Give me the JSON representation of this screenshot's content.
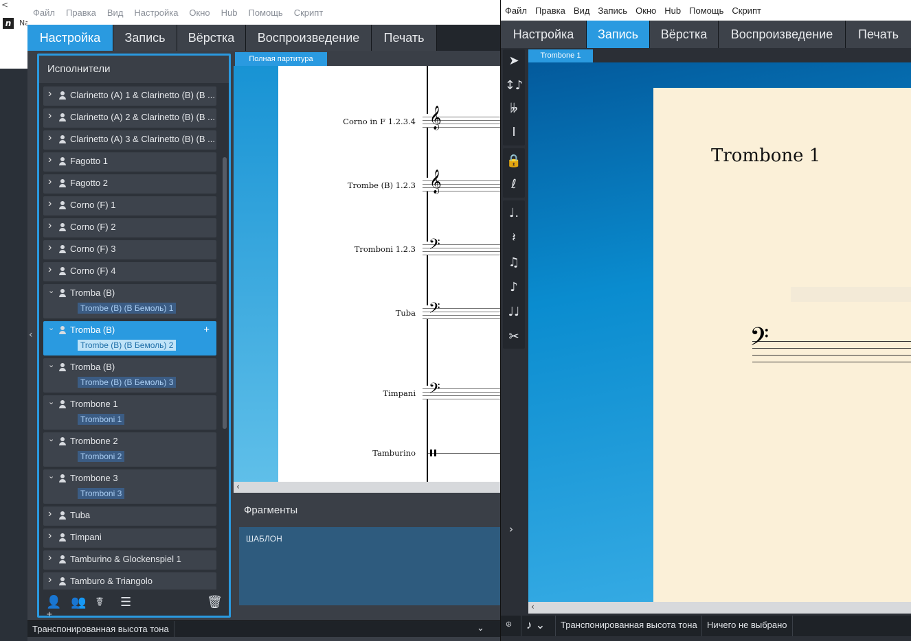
{
  "desktop": {
    "logo": "n",
    "title_stub": "Na",
    "back_glyph": "<"
  },
  "left_window": {
    "menu": [
      "Файл",
      "Правка",
      "Вид",
      "Настройка",
      "Окно",
      "Hub",
      "Помощь",
      "Скрипт"
    ],
    "tabs": [
      "Настройка",
      "Запись",
      "Вёрстка",
      "Воспроизведение",
      "Печать"
    ],
    "active_tab": "Настройка",
    "performers": {
      "title": "Исполнители",
      "items": [
        {
          "label": "Clarinetto (A) 1 & Clarinetto (B) (B ...",
          "expanded": false
        },
        {
          "label": "Clarinetto (A) 2 & Clarinetto (B) (B ...",
          "expanded": false
        },
        {
          "label": "Clarinetto (A) 3 & Clarinetto (B) (B ...",
          "expanded": false
        },
        {
          "label": "Fagotto 1",
          "expanded": false
        },
        {
          "label": "Fagotto 2",
          "expanded": false
        },
        {
          "label": "Corno (F) 1",
          "expanded": false
        },
        {
          "label": "Corno (F) 2",
          "expanded": false
        },
        {
          "label": "Corno (F) 3",
          "expanded": false
        },
        {
          "label": "Corno (F) 4",
          "expanded": false
        },
        {
          "label": "Tromba (B)",
          "expanded": true,
          "sub": "Trombe (B) (B Бемоль) 1"
        },
        {
          "label": "Tromba (B)",
          "expanded": true,
          "sub": "Trombe (B) (B Бемоль) 2",
          "selected": true
        },
        {
          "label": "Tromba (B)",
          "expanded": true,
          "sub": "Trombe (B) (B Бемоль) 3"
        },
        {
          "label": "Trombone 1",
          "expanded": true,
          "sub": "Tromboni 1"
        },
        {
          "label": "Trombone 2",
          "expanded": true,
          "sub": "Tromboni 2"
        },
        {
          "label": "Trombone 3",
          "expanded": true,
          "sub": "Tromboni 3"
        },
        {
          "label": "Tuba",
          "expanded": false
        },
        {
          "label": "Timpani",
          "expanded": false
        },
        {
          "label": "Tamburino & Glockenspiel 1",
          "expanded": false
        },
        {
          "label": "Tamburo & Triangolo",
          "expanded": false
        }
      ],
      "tools": [
        "add-performer-icon",
        "add-ensemble-icon",
        "add-section-icon",
        "group-icon",
        "trash-icon"
      ]
    },
    "score": {
      "tab": "Полная партитура",
      "instruments": [
        "Corno in F  1.2.3.4",
        "Trombe (B)  1.2.3",
        "Tromboni  1.2.3",
        "Tuba",
        "Timpani",
        "Tamburino"
      ]
    },
    "fragments": {
      "title": "Фрагменты",
      "item": "ШАБЛОН"
    },
    "status": {
      "transposition": "Транспонированная высота тона"
    }
  },
  "right_window": {
    "menu": [
      "Файл",
      "Правка",
      "Вид",
      "Запись",
      "Окно",
      "Hub",
      "Помощь",
      "Скрипт"
    ],
    "tabs": [
      "Настройка",
      "Запись",
      "Вёрстка",
      "Воспроизведение",
      "Печать"
    ],
    "active_tab": "Запись",
    "part_tab": "Trombone 1",
    "part_title": "Trombone 1",
    "status": {
      "transposition": "Транспонированная высота тона",
      "selection": "Ничего не выбрано"
    }
  },
  "colors": {
    "accent": "#2a9ae0",
    "panel": "#2d3239",
    "paper": "#fbf0d8"
  }
}
